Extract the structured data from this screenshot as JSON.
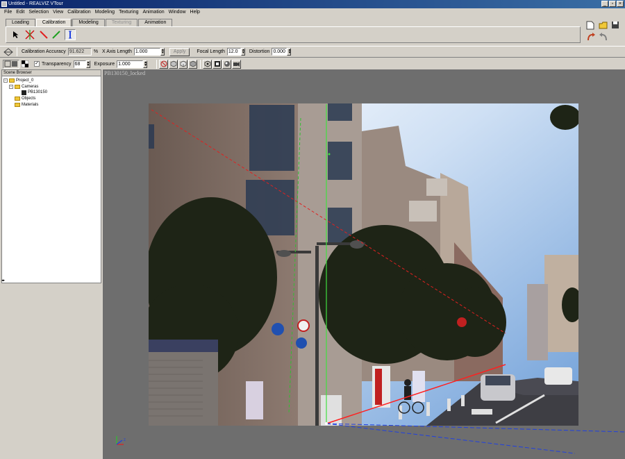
{
  "window": {
    "title": "Untitled - REALVIZ VTour"
  },
  "menu": [
    "File",
    "Edit",
    "Selection",
    "View",
    "Calibration",
    "Modeling",
    "Texturing",
    "Animation",
    "Window",
    "Help"
  ],
  "tabs": [
    {
      "label": "Loading",
      "state": "normal"
    },
    {
      "label": "Calibration",
      "state": "active"
    },
    {
      "label": "Modeling",
      "state": "normal"
    },
    {
      "label": "Texturing",
      "state": "disabled"
    },
    {
      "label": "Animation",
      "state": "normal"
    }
  ],
  "tools": [
    "select-arrow-icon",
    "vanishing-point-icon",
    "x-axis-line-icon",
    "y-axis-line-icon",
    "z-axis-line-icon"
  ],
  "calib": {
    "accuracy_label": "Calibration Accuracy",
    "accuracy_value": "91.622",
    "accuracy_unit": "%",
    "xaxis_label": "X Axis Length",
    "xaxis_value": "1.000",
    "apply_label": "Apply",
    "focal_label": "Focal Length",
    "focal_value": "12.0",
    "distortion_label": "Distortion",
    "distortion_value": "0.000"
  },
  "display": {
    "transparency_label": "Transparency",
    "transparency_value": "68",
    "exposure_label": "Exposure",
    "exposure_value": "1.000"
  },
  "scene_browser": {
    "title": "Scene Browser",
    "project": "Project_0",
    "cameras": "Cameras",
    "camera_item": "PB130150",
    "objects": "Objects",
    "materials": "Materials"
  },
  "viewport": {
    "image_name": "PB130150_locked"
  },
  "colors": {
    "title_start": "#0a246a",
    "title_end": "#3a6ea5",
    "chrome": "#d4d0c8",
    "viewport_bg": "#6e6e6e",
    "x_axis": "#e02020",
    "y_axis": "#20c020",
    "z_axis": "#2040e0"
  }
}
